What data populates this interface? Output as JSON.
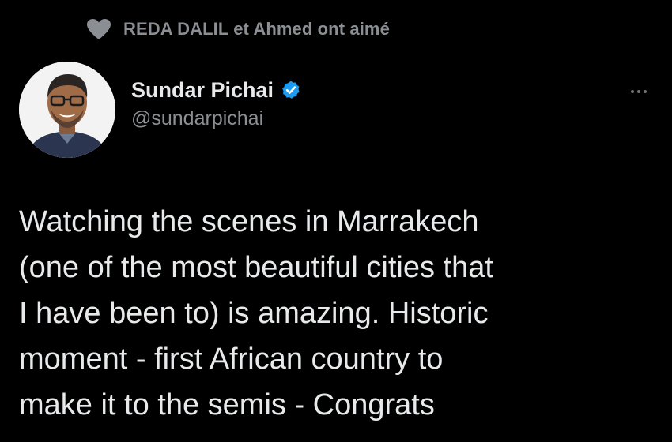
{
  "social_context": {
    "icon": "heart-icon",
    "text": "REDA DALIL et Ahmed ont aimé"
  },
  "author": {
    "display_name": "Sundar Pichai",
    "handle": "@sundarpichai",
    "verified_icon": "verified-badge-icon"
  },
  "menu": {
    "icon": "more-options-icon"
  },
  "tweet": {
    "text": "Watching the scenes in Marrakech\n(one of the most beautiful cities that\nI have been to) is amazing. Historic\nmoment - first African country to\nmake it to the semis - Congrats"
  },
  "colors": {
    "background": "#000000",
    "primary_text": "#e7e9ea",
    "secondary_text": "#8b8f94",
    "verified_blue": "#1d9bf0"
  }
}
